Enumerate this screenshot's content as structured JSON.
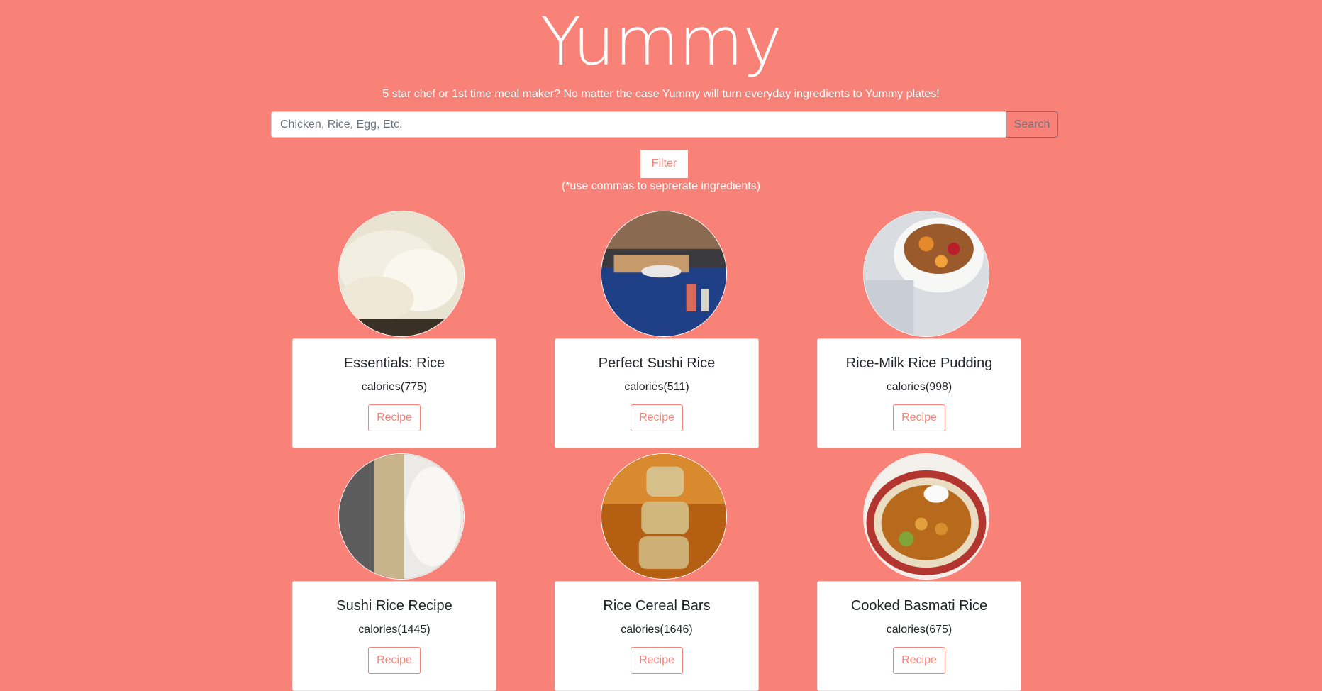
{
  "header": {
    "title": "Yummy",
    "tagline": "5 star chef or 1st time meal maker? No matter the case Yummy will turn everyday ingredients to Yummy plates!"
  },
  "search": {
    "placeholder": "Chicken, Rice, Egg, Etc.",
    "value": "",
    "button_label": "Search"
  },
  "filter": {
    "button_label": "Filter",
    "hint": "(*use commas to seprerate ingredients)"
  },
  "recipes": [
    {
      "title": "Essentials: Rice",
      "calories": "calories(775)",
      "button_label": "Recipe",
      "image": "plain-rice-photo"
    },
    {
      "title": "Perfect Sushi Rice",
      "calories": "calories(511)",
      "button_label": "Recipe",
      "image": "sushi-table-photo"
    },
    {
      "title": "Rice-Milk Rice Pudding",
      "calories": "calories(998)",
      "button_label": "Recipe",
      "image": "rice-pudding-bowl-photo"
    },
    {
      "title": "Sushi Rice Recipe",
      "calories": "calories(1445)",
      "button_label": "Recipe",
      "image": "sushi-mat-rice-photo"
    },
    {
      "title": "Rice Cereal Bars",
      "calories": "calories(1646)",
      "button_label": "Recipe",
      "image": "cereal-bars-stack-photo"
    },
    {
      "title": "Cooked Basmati Rice",
      "calories": "calories(675)",
      "button_label": "Recipe",
      "image": "basmati-curry-plate-photo"
    }
  ],
  "colors": {
    "background": "#f88178",
    "accent": "#f88178",
    "card": "#ffffff",
    "text": "#212529"
  }
}
